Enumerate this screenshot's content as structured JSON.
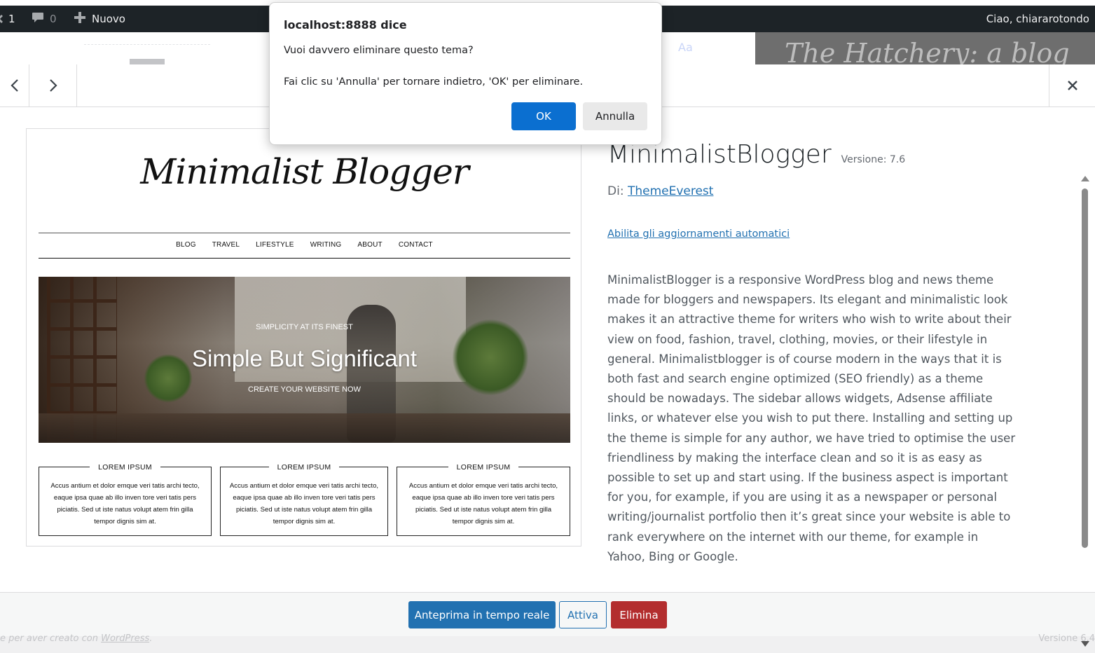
{
  "admin_bar": {
    "updates_count": "1",
    "comments_count": "0",
    "new_label": "Nuovo",
    "greeting": "Ciao, chiararotondo"
  },
  "background": {
    "blog_title_fragment": "The Hatchery: a blog",
    "aa_label": "Aa",
    "footer_thanks_prefix": "e per aver creato con ",
    "footer_thanks_link": "WordPress",
    "footer_thanks_suffix": ".",
    "footer_version": "Versione 6.4"
  },
  "dialog": {
    "title": "localhost:8888 dice",
    "message_line1": "Vuoi davvero eliminare questo tema?",
    "message_line2": "Fai clic su 'Annulla' per tornare indietro, 'OK' per eliminare.",
    "ok_label": "OK",
    "cancel_label": "Annulla"
  },
  "theme": {
    "name": "MinimalistBlogger",
    "version_label": "Versione: 7.6",
    "author_prefix": "Di:",
    "author_name": "ThemeEverest",
    "auto_updates_link": "Abilita gli aggiornamenti automatici",
    "description": "MinimalistBlogger is a responsive WordPress blog and news theme made for bloggers and newspapers. Its elegant and minimalistic look makes it an attractive theme for writers who wish to write about their view on food, fashion, travel, clothing, movies, or their lifestyle in general. Minimalistblogger is of course modern in the ways that it is both fast and search engine optimized (SEO friendly) as a theme should be nowadays. The sidebar allows widgets, Adsense affiliate links, or whatever else you wish to put there. Installing and setting up the theme is simple for any author, we have tried to optimise the user friendliness by making the interface clean and so it is as easy as possible to set up and start using. If the business aspect is important for you, for example, if you are using it as a newspaper or personal writing/journalist portfolio then it’s great since your website is able to rank everywhere on the internet with our theme, for example in Yahoo, Bing or Google."
  },
  "screenshot": {
    "logo": "Minimalist Blogger",
    "menu": [
      "BLOG",
      "TRAVEL",
      "LIFESTYLE",
      "WRITING",
      "ABOUT",
      "CONTACT"
    ],
    "hero_kicker": "SIMPLICITY AT ITS FINEST",
    "hero_title": "Simple But Significant",
    "hero_cta": "CREATE YOUR WEBSITE NOW",
    "cards": [
      {
        "label": "LOREM IPSUM",
        "text": "Accus antium et dolor emque veri tatis archi tecto, eaque ipsa quae ab illo inven tore veri tatis pers piciatis. Sed ut iste natus volupt atem frin gilla tempor dignis sim at."
      },
      {
        "label": "LOREM IPSUM",
        "text": "Accus antium et dolor emque veri tatis archi tecto, eaque ipsa quae ab illo inven tore veri tatis pers piciatis. Sed ut iste natus volupt atem frin gilla tempor dignis sim at."
      },
      {
        "label": "LOREM IPSUM",
        "text": "Accus antium et dolor emque veri tatis archi tecto, eaque ipsa quae ab illo inven tore veri tatis pers piciatis. Sed ut iste natus volupt atem frin gilla tempor dignis sim at."
      }
    ]
  },
  "actions": {
    "preview_label": "Anteprima in tempo reale",
    "activate_label": "Attiva",
    "delete_label": "Elimina"
  },
  "colors": {
    "primary": "#2271b1",
    "danger": "#b32d2e",
    "admin_bar_bg": "#1d2327",
    "dialog_ok": "#0b6fd0"
  },
  "icons": [
    "wordpress-updates-icon",
    "comment-bubble-icon",
    "plus-icon",
    "chevron-left-icon",
    "chevron-right-icon",
    "close-icon",
    "scroll-up-arrow-icon",
    "scroll-down-arrow-icon"
  ]
}
